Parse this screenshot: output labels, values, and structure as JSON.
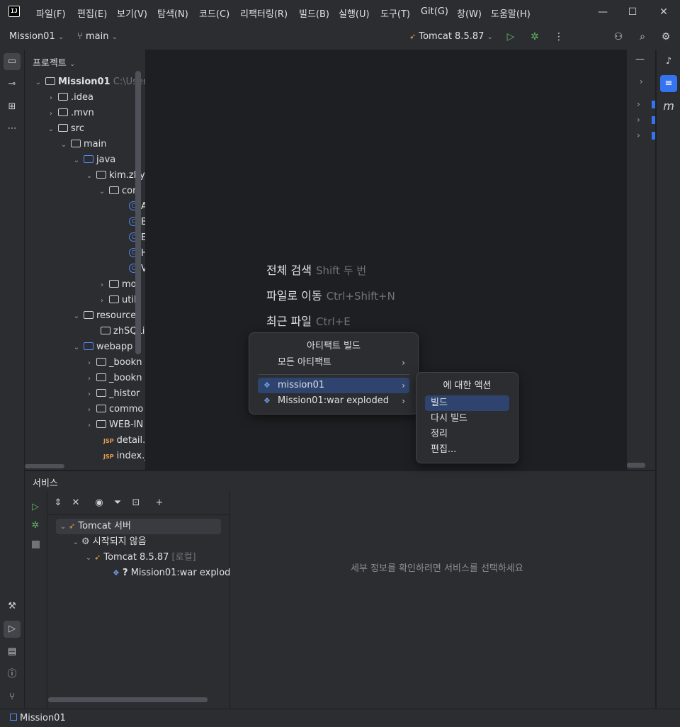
{
  "menu": {
    "items": [
      "파일(F)",
      "편집(E)",
      "보기(V)",
      "탐색(N)",
      "코드(C)",
      "리팩터링(R)",
      "빌드(B)",
      "실행(U)",
      "도구(T)",
      "Git(G)",
      "창(W)",
      "도움말(H)"
    ]
  },
  "toolbar": {
    "project": "Mission01",
    "branch": "main",
    "run_config": "Tomcat 8.5.87"
  },
  "project": {
    "header": "프로젝트",
    "root": "Mission01",
    "root_path": "C:\\Users",
    "rows": [
      ".idea",
      ".mvn",
      "src",
      "main",
      "java",
      "kim.zhy",
      "con",
      "A",
      "B",
      "E",
      "H",
      "V",
      "moc",
      "util",
      "resources",
      "zhSQLi",
      "webapp",
      "_bookn",
      "_bookn",
      "_histor",
      "commo",
      "WEB-IN",
      "detail.js",
      "index.js"
    ]
  },
  "editor": {
    "hints": [
      {
        "action": "전체 검색",
        "key": "Shift 두 번"
      },
      {
        "action": "파일로 이동",
        "key": "Ctrl+Shift+N"
      },
      {
        "action": "최근 파일",
        "key": "Ctrl+E"
      }
    ]
  },
  "popup_build": {
    "title": "아티팩트 빌드",
    "all": "모든 아티팩트",
    "items": [
      "mission01",
      "Mission01:war exploded"
    ]
  },
  "popup_actions": {
    "title": "에 대한 액션",
    "items": [
      "빌드",
      "다시 빌드",
      "정리",
      "편집..."
    ]
  },
  "services": {
    "title": "서비스",
    "tree": {
      "server": "Tomcat 서버",
      "state": "시작되지 않음",
      "instance": "Tomcat 8.5.87",
      "instance_tag": "[로컬]",
      "artifact": "Mission01:war explod"
    },
    "detail_hint": "세부 정보를 확인하려면 서비스를 선택하세요"
  },
  "statusbar": {
    "path": "Mission01"
  }
}
